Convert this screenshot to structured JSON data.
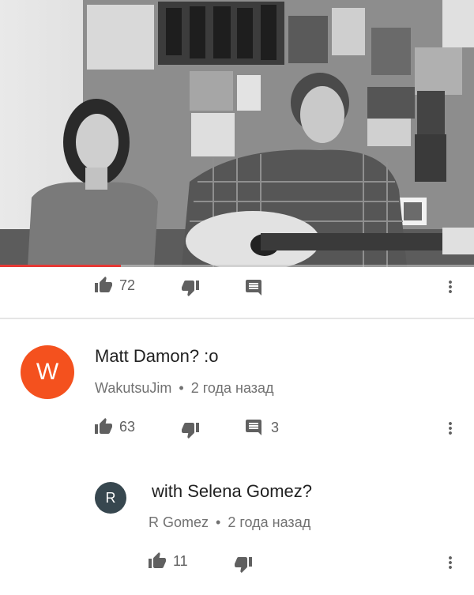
{
  "video": {
    "progress": 0.255,
    "accent_color": "#e53935"
  },
  "video_actions": {
    "like_count": "72",
    "like_icon": "thumb-up-icon",
    "dislike_icon": "thumb-down-icon",
    "reply_icon": "comment-icon",
    "more_icon": "more-vert-icon"
  },
  "comments": [
    {
      "avatar_letter": "W",
      "avatar_color": "#f4511e",
      "text": "Matt Damon? :o",
      "author": "WakutsuJim",
      "separator": "•",
      "time": "2 года назад",
      "like_count": "63",
      "reply_count": "3"
    },
    {
      "avatar_letter": "R",
      "avatar_color": "#37474f",
      "text": "with Selena Gomez?",
      "author": "R Gomez",
      "separator": "•",
      "time": "2 года назад",
      "like_count": "11"
    }
  ]
}
